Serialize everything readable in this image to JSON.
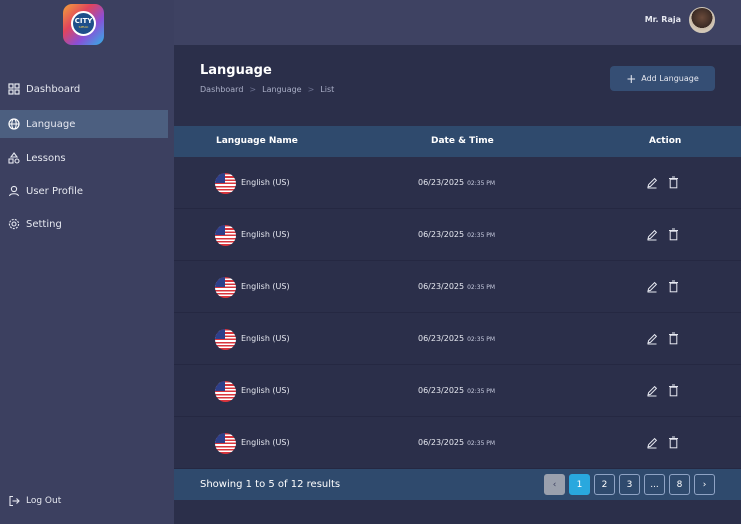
{
  "sidebar": {
    "logo": {
      "line1": "CITY",
      "line2": "SPEAK"
    },
    "items": [
      {
        "label": "Dashboard",
        "icon": "grid-icon"
      },
      {
        "label": "Language",
        "icon": "globe-icon",
        "active": true
      },
      {
        "label": "Lessons",
        "icon": "shapes-icon"
      },
      {
        "label": "User Profile",
        "icon": "user-icon"
      },
      {
        "label": "Setting",
        "icon": "gear-icon"
      }
    ],
    "logout": "Log Out"
  },
  "topbar": {
    "user_name": "Mr. Raja"
  },
  "page": {
    "title": "Language",
    "breadcrumb": [
      "Dashboard",
      "Language",
      "List"
    ],
    "add_button": "Add Language"
  },
  "table": {
    "columns": [
      "Language Name",
      "Date & Time",
      "Action"
    ],
    "rows": [
      {
        "language": "English (US)",
        "date": "06/23/2025",
        "time": "02:35 PM"
      },
      {
        "language": "English (US)",
        "date": "06/23/2025",
        "time": "02:35 PM"
      },
      {
        "language": "English (US)",
        "date": "06/23/2025",
        "time": "02:35 PM"
      },
      {
        "language": "English (US)",
        "date": "06/23/2025",
        "time": "02:35 PM"
      },
      {
        "language": "English (US)",
        "date": "06/23/2025",
        "time": "02:35 PM"
      },
      {
        "language": "English (US)",
        "date": "06/23/2025",
        "time": "02:35 PM"
      }
    ]
  },
  "pagination": {
    "summary": "Showing 1 to 5 of 12 results",
    "pages": [
      "1",
      "2",
      "3",
      "...",
      "8"
    ],
    "current": "1",
    "prev": "‹",
    "next": "›"
  },
  "colors": {
    "sidebar_bg": "#3c4060",
    "content_bg": "#2b2f4a",
    "header_bg": "#2f4a6d",
    "accent": "#29a8de"
  }
}
